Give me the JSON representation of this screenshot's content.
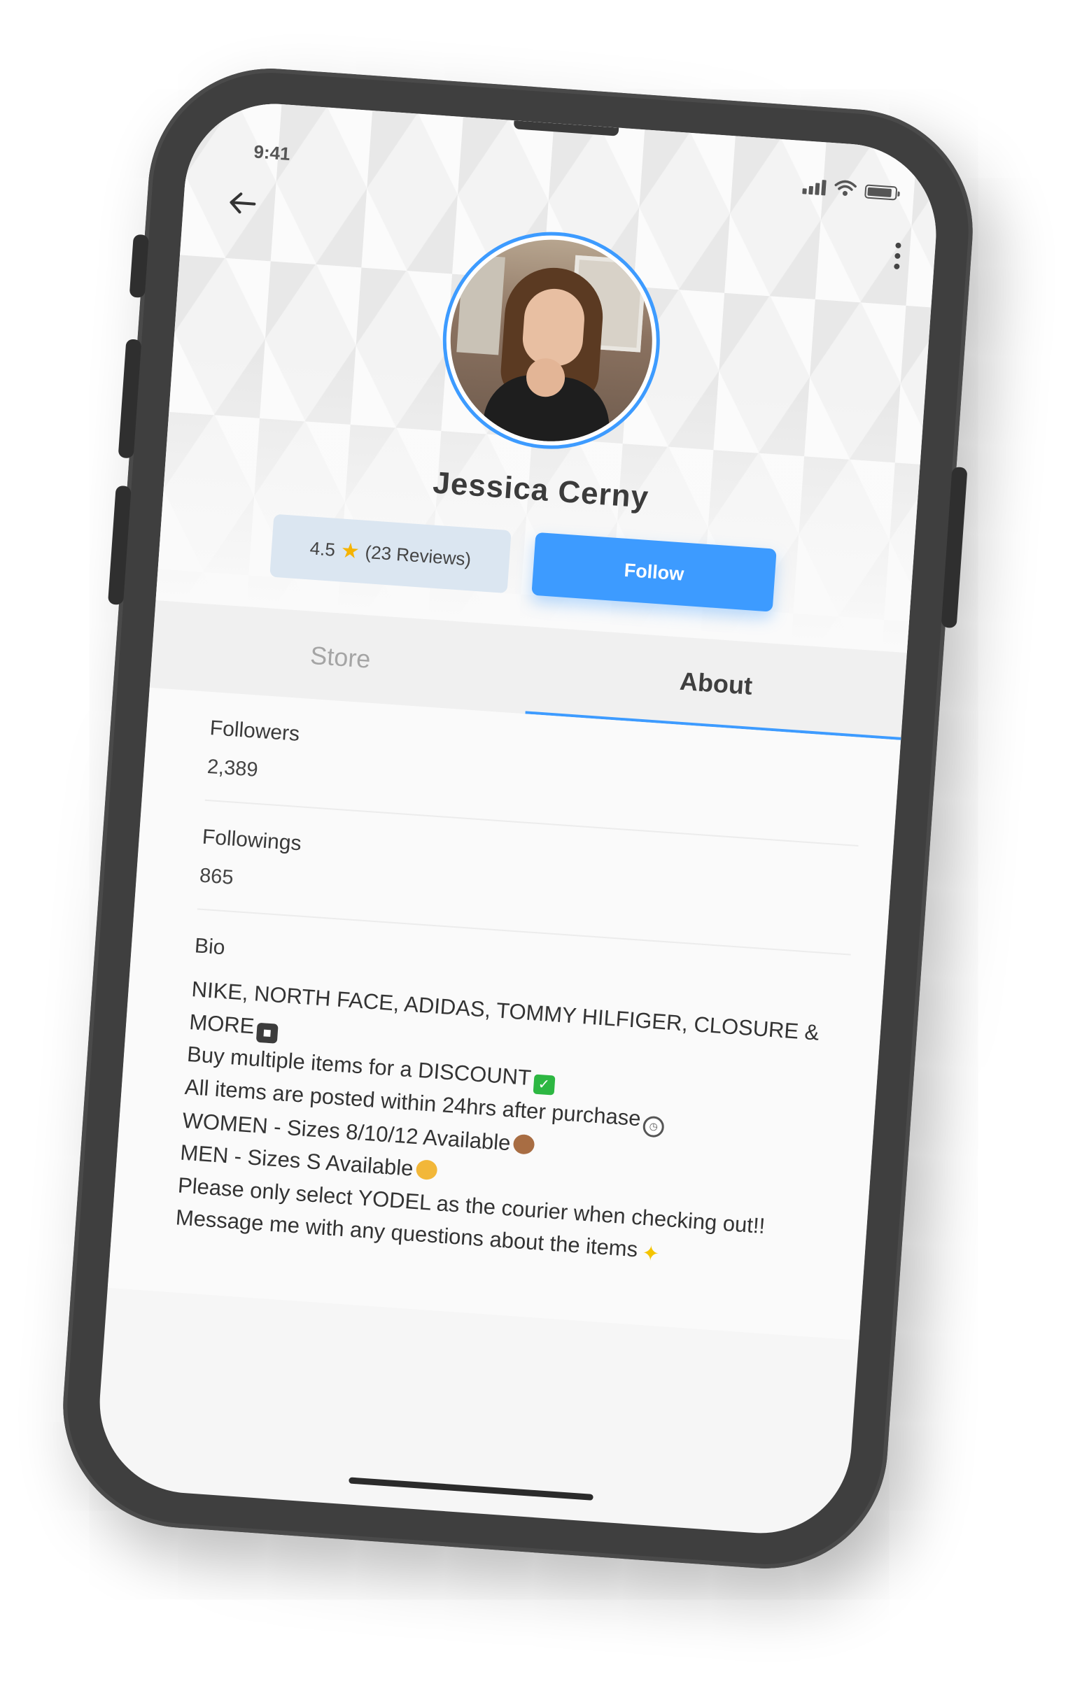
{
  "status_bar": {
    "time": "9:41"
  },
  "profile": {
    "name": "Jessica Cerny",
    "rating": "4.5",
    "reviews": "(23 Reviews)",
    "follow_label": "Follow"
  },
  "tabs": [
    {
      "label": "Store",
      "active": false
    },
    {
      "label": "About",
      "active": true
    }
  ],
  "about": {
    "followers": {
      "label": "Followers",
      "value": "2,389"
    },
    "followings": {
      "label": "Followings",
      "value": "865"
    },
    "bio": {
      "label": "Bio",
      "lines": [
        "NIKE, NORTH FACE, ADIDAS, TOMMY HILFIGER, CLOSURE & MORE",
        "Buy multiple items for a DISCOUNT",
        "All items are posted within 24hrs after purchase",
        "WOMEN - Sizes 8/10/12 Available",
        "MEN - Sizes S Available",
        "Please only select YODEL as the courier when checking out!!",
        "Message me with any questions about the items"
      ]
    }
  },
  "icons": {
    "back": "arrow-left-icon",
    "more": "more-vertical-icon",
    "star": "star-icon",
    "signal": "signal-icon",
    "wifi": "wifi-icon",
    "battery": "battery-icon"
  },
  "colors": {
    "accent": "#3d9bff",
    "rating_bg": "#dbe6f1",
    "star": "#f5b301",
    "phone_body": "#3f3f3f"
  }
}
